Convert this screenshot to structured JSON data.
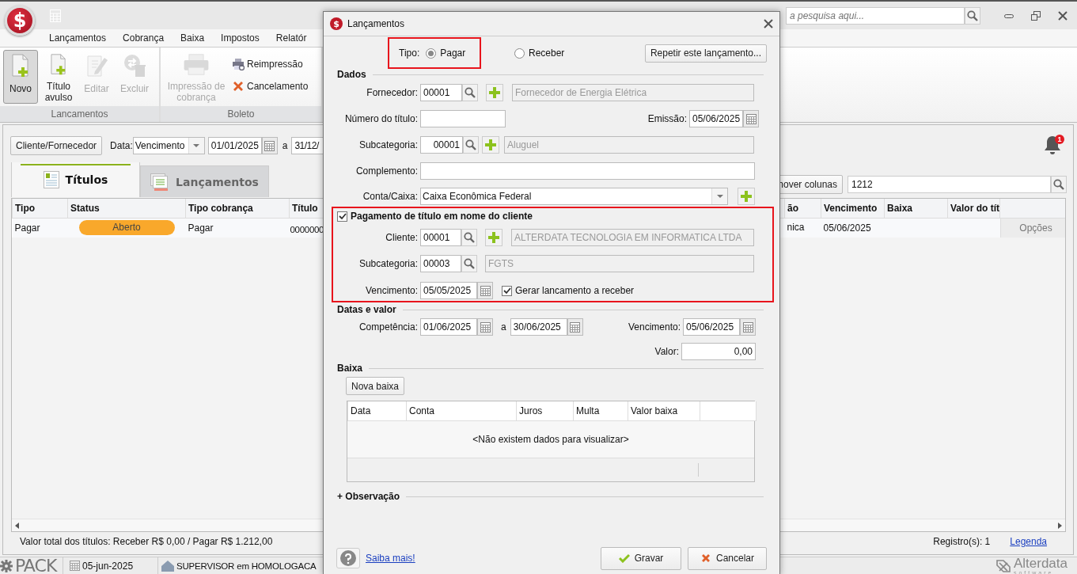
{
  "app": {
    "logo": "$",
    "search": {
      "placeholder": "a pesquisa aqui..."
    },
    "menu": [
      {
        "label": "Lançamentos"
      },
      {
        "label": "Cobrança"
      },
      {
        "label": "Baixa"
      },
      {
        "label": "Impostos"
      },
      {
        "label": "Relatór"
      }
    ],
    "ribbon": [
      {
        "label": "Lancamentos",
        "buttons": [
          {
            "label": "Novo",
            "disabled": false,
            "selected": true
          },
          {
            "label": "Título avulso",
            "disabled": false,
            "selected": false
          },
          {
            "label": "Editar",
            "disabled": true,
            "selected": false
          },
          {
            "label": "Excluir",
            "disabled": true,
            "selected": false
          }
        ]
      },
      {
        "label": "Boleto",
        "buttons": [
          {
            "label": "Impressão de cobrança",
            "disabled": true,
            "selected": false
          }
        ],
        "small_buttons": [
          {
            "label": "Reimpressão"
          },
          {
            "label": "Cancelamento"
          }
        ]
      }
    ]
  },
  "filter": {
    "button": "Cliente/Fornecedor",
    "date_label": "Data:",
    "date_field": "Vencimento",
    "from": "01/01/2025",
    "separator": "a",
    "to": "31/12/",
    "notifications": "1"
  },
  "tabs": [
    {
      "label": "Títulos",
      "selected": true
    },
    {
      "label": "Lançamentos",
      "selected": false
    }
  ],
  "columns_button": "nover colunas",
  "grid_search": {
    "value": "1212"
  },
  "table": {
    "columns": [
      "Tipo",
      "Status",
      "Tipo cobrança",
      "Título",
      "ão",
      "Vencimento",
      "Baixa",
      "Valor do tít"
    ],
    "rows": [
      {
        "cells": [
          "Pagar",
          "Aberto",
          "Pagar",
          "0000000",
          "nica",
          "05/06/2025"
        ],
        "action": "Opções"
      }
    ]
  },
  "footer": {
    "total": "Valor total dos títulos: Receber R$ 0,00 / Pagar R$ 1.212,00",
    "records": "Registro(s): 1",
    "legend_link": "Legenda"
  },
  "status_bar": {
    "product": "PACK",
    "date": "05-jun-2025",
    "user": "SUPERVISOR em HOMOLOGACA",
    "brand": "Alterdata",
    "brand_sub": "software"
  },
  "dialog": {
    "icon": "$",
    "title": "Lançamentos",
    "tipo": {
      "label": "Tipo:",
      "highlighted": true,
      "options": [
        {
          "label": "Pagar",
          "selected": true
        },
        {
          "label": "Receber",
          "selected": false
        }
      ]
    },
    "repeat_button": "Repetir este lançamento...",
    "dados": {
      "heading": "Dados",
      "fornecedor": {
        "label": "Fornecedor:",
        "code": "00001",
        "name": "Fornecedor de Energia Elétrica"
      },
      "numero": {
        "label": "Número do título:"
      },
      "emissao": {
        "label": "Emissão:",
        "value": "05/06/2025"
      },
      "subcategoria": {
        "label": "Subcategoria:",
        "code": "00001",
        "name": "Aluguel"
      },
      "complemento": {
        "label": "Complemento:"
      },
      "conta": {
        "label": "Conta/Caixa:",
        "value": "Caixa Econômica Federal"
      }
    },
    "cliente_section": {
      "label": "Pagamento de título em nome do cliente",
      "checked": true,
      "highlighted": true,
      "cliente": {
        "label": "Cliente:",
        "code": "00001",
        "name": "ALTERDATA TECNOLOGIA EM INFORMATICA LTDA"
      },
      "subcategoria": {
        "label": "Subcategoria:",
        "code": "00003",
        "name": "FGTS"
      },
      "vencimento": {
        "label": "Vencimento:",
        "value": "05/05/2025"
      },
      "gerar": {
        "label": "Gerar lancamento a receber",
        "checked": true
      }
    },
    "datas": {
      "heading": "Datas e valor",
      "competencia": {
        "label": "Competência:",
        "from": "01/06/2025",
        "separator": "a",
        "to": "30/06/2025"
      },
      "vencimento": {
        "label": "Vencimento:",
        "value": "05/06/2025"
      },
      "valor": {
        "label": "Valor:",
        "value": "0,00"
      }
    },
    "baixa": {
      "heading": "Baixa",
      "new_button": "Nova baixa",
      "columns": [
        "Data",
        "Conta",
        "Juros",
        "Multa",
        "Valor baixa"
      ],
      "empty_message": "<Não existem dados para visualizar>"
    },
    "observacao": "+ Observação",
    "help_link": "Saiba mais!",
    "buttons": [
      {
        "label": "Gravar",
        "kind": "save"
      },
      {
        "label": "Cancelar",
        "kind": "cancel"
      }
    ]
  }
}
